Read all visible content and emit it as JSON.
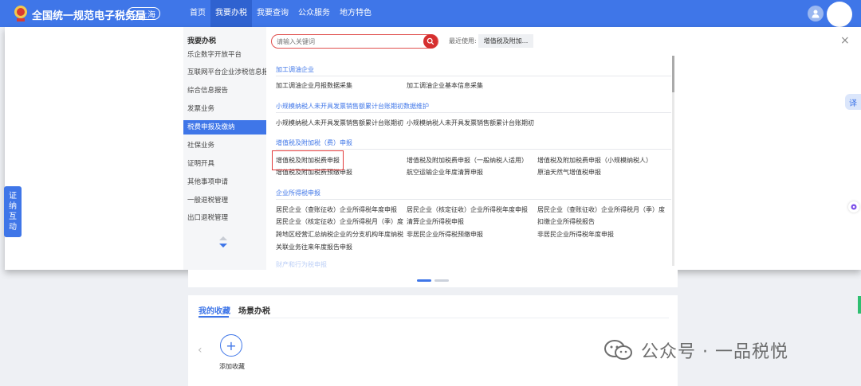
{
  "header": {
    "site_title": "全国统一规范电子税务局",
    "region": "上海",
    "nav": [
      "首页",
      "我要办税",
      "我要查询",
      "公众服务",
      "地方特色"
    ],
    "active_nav_index": 1
  },
  "menu": {
    "sidebar_title": "我要办税",
    "sidebar_items": [
      "乐企数字开放平台",
      "互联网平台企业涉税信息报送",
      "综合信息报告",
      "发票业务",
      "税费申报及缴纳",
      "社保业务",
      "证明开具",
      "其他事项申请",
      "一般退税管理",
      "出口退税管理"
    ],
    "active_sidebar_index": 4,
    "search_placeholder": "请输入关键词",
    "recent_label": "最近使用:",
    "recent_item": "增值税及附加...",
    "close_symbol": "×",
    "categories": [
      {
        "title": "加工调油企业",
        "items": [
          "加工调油企业月报数据采集",
          "加工调油企业基本信息采集"
        ]
      },
      {
        "title": "小规模纳税人未开具发票销售额累计台账期初数据维护",
        "items": [
          "小规模纳税人未开具发票销售额累计台账期初...",
          "小规模纳税人未开具发票销售额累计台账期初..."
        ]
      },
      {
        "title": "增值税及附加税（费）申报",
        "items": [
          "增值税及附加税费申报",
          "增值税及附加税费申报（一般纳税人适用）",
          "增值税及附加税费申报（小规模纳税人）",
          "增值税及附加税费预缴申报",
          "航空运输企业年度清算申报",
          "原油天然气增值税申报"
        ]
      },
      {
        "title": "企业所得税申报",
        "items": [
          "居民企业（查账征收）企业所得税年度申报",
          "居民企业（核定征收）企业所得税年度申报",
          "居民企业（查账征收）企业所得税月（季）度...",
          "居民企业（核定征收）企业所得税月（季）度...",
          "清算企业所得税申报",
          "扣缴企业所得税报告",
          "跨地区经营汇总纳税企业的分支机构年度纳税...",
          "非居民企业所得税预缴申报",
          "非居民企业所得税年度申报",
          "关联业务往来年度报告申报"
        ]
      }
    ],
    "trailing_category": "财产和行为税申报"
  },
  "side_tab": [
    "证",
    "纳",
    "互",
    "动"
  ],
  "favorites": {
    "tabs": [
      "我的收藏",
      "场景办税"
    ],
    "active_tab_index": 0,
    "add_label": "添加收藏",
    "add_symbol": "+",
    "prev_symbol": "‹"
  },
  "floating": {
    "translate_label": "译"
  },
  "watermark": {
    "text": "公众号 · 一品税悦"
  },
  "colors": {
    "primary": "#3f76e8",
    "highlight": "#e23b3b",
    "search_button": "#d62f2f"
  }
}
